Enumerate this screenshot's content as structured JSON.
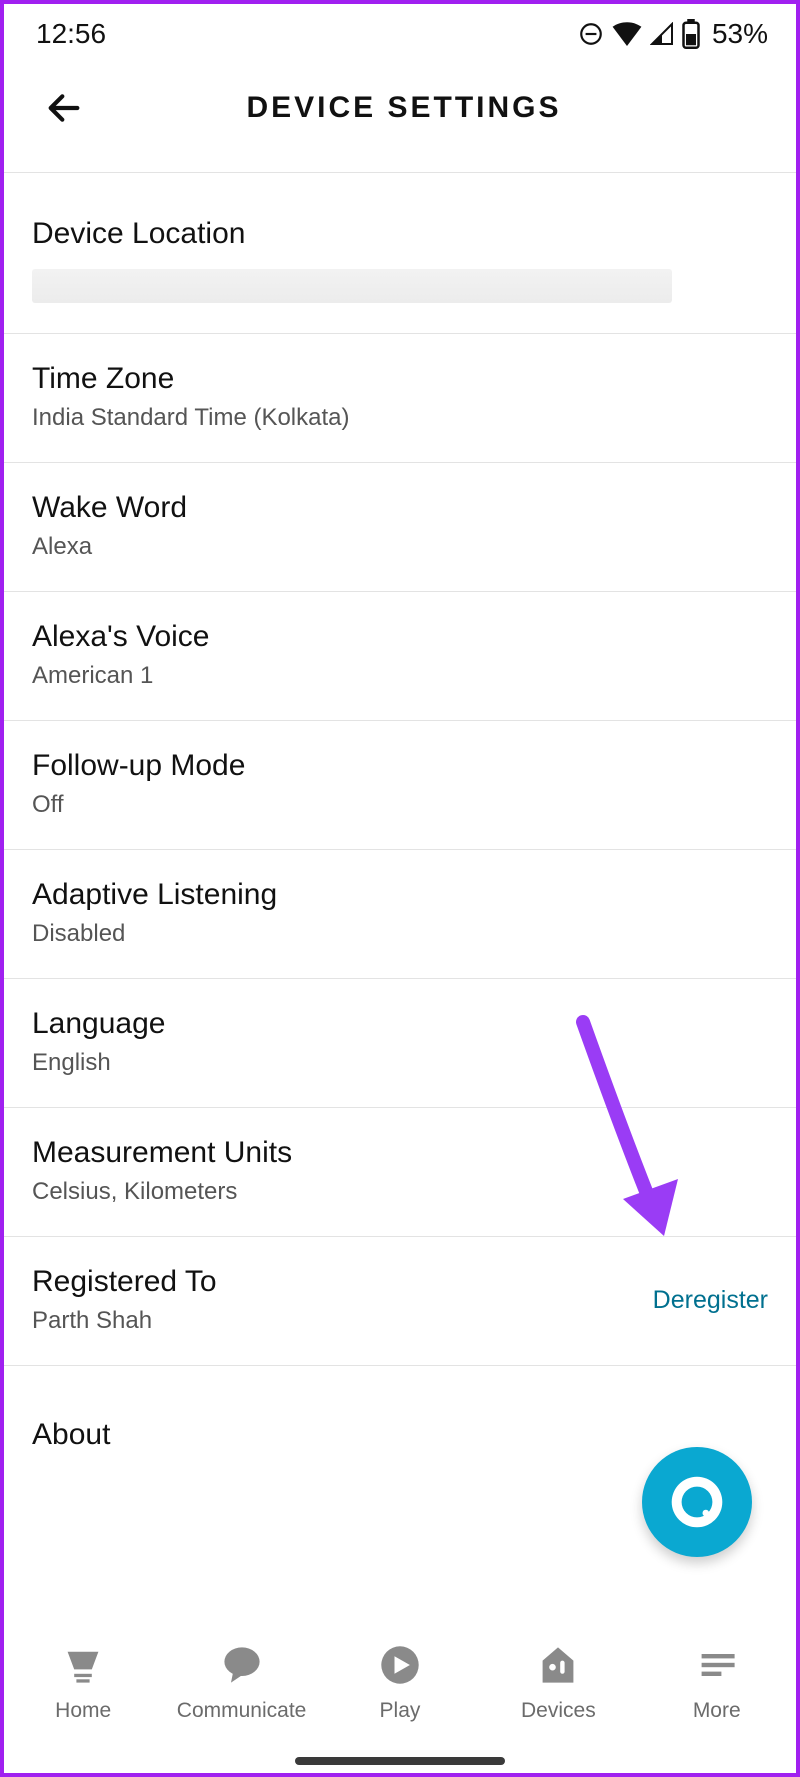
{
  "status": {
    "time": "12:56",
    "battery": "53%"
  },
  "header": {
    "title": "DEVICE SETTINGS"
  },
  "rows": {
    "deviceLocation": {
      "label": "Device Location"
    },
    "timeZone": {
      "label": "Time Zone",
      "value": "India Standard Time (Kolkata)"
    },
    "wakeWord": {
      "label": "Wake Word",
      "value": "Alexa"
    },
    "voice": {
      "label": "Alexa's Voice",
      "value": "American 1"
    },
    "followUp": {
      "label": "Follow-up Mode",
      "value": "Off"
    },
    "adaptive": {
      "label": "Adaptive Listening",
      "value": "Disabled"
    },
    "language": {
      "label": "Language",
      "value": "English"
    },
    "measurement": {
      "label": "Measurement Units",
      "value": "Celsius, Kilometers"
    },
    "registered": {
      "label": "Registered To",
      "value": "Parth Shah",
      "action": "Deregister"
    },
    "about": {
      "label": "About"
    }
  },
  "nav": {
    "home": "Home",
    "communicate": "Communicate",
    "play": "Play",
    "devices": "Devices",
    "more": "More"
  }
}
